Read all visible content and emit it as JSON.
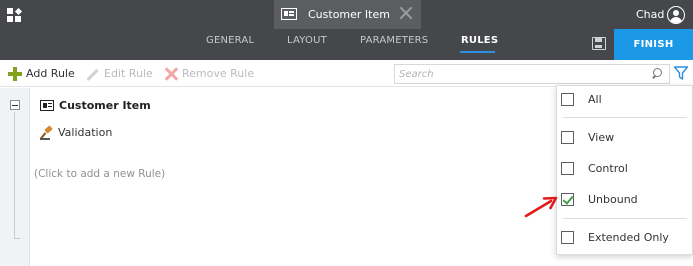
{
  "header": {
    "document_tab_title": "Customer Item",
    "user_name": "Chad"
  },
  "tabs": [
    {
      "label": "GENERAL",
      "active": false
    },
    {
      "label": "LAYOUT",
      "active": false
    },
    {
      "label": "PARAMETERS",
      "active": false
    },
    {
      "label": "RULES",
      "active": true
    }
  ],
  "finish_label": "FINISH",
  "toolbar": {
    "add_rule": "Add Rule",
    "edit_rule": "Edit Rule",
    "remove_rule": "Remove Rule",
    "search_placeholder": "Search"
  },
  "rules_tree": {
    "root_name": "Customer Item",
    "child_label": "Validation",
    "add_hint": "(Click to add a new Rule)"
  },
  "filter_dropdown": {
    "items": [
      {
        "label": "All",
        "checked": false
      },
      {
        "label": "View",
        "checked": false
      },
      {
        "label": "Control",
        "checked": false
      },
      {
        "label": "Unbound",
        "checked": true
      },
      {
        "label": "Extended Only",
        "checked": false
      }
    ]
  },
  "colors": {
    "header_bg": "#45474a",
    "finish_bg": "#1b98e6",
    "active_tab_underline": "#2c8fe0",
    "add_icon": "#84a11b",
    "checkmark": "#43a047",
    "annotation_arrow": "#e01b1b"
  }
}
